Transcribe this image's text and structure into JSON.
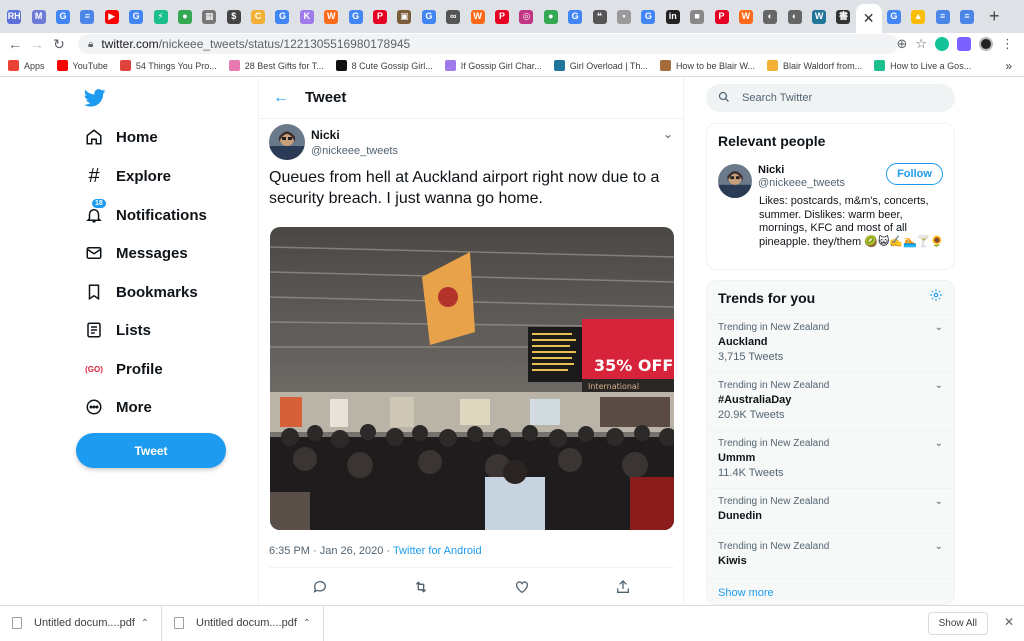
{
  "browser": {
    "tabs": [
      {
        "icon": "outline-icon",
        "color": "#5b6fd8",
        "glyph": "RH"
      },
      {
        "icon": "bookmark-icon",
        "color": "#6d7bd6",
        "glyph": "M"
      },
      {
        "icon": "google-icon",
        "color": "#4285f4",
        "glyph": "G"
      },
      {
        "icon": "docs-icon",
        "color": "#4a86e8",
        "glyph": "≡"
      },
      {
        "icon": "youtube-icon",
        "color": "#ff0000",
        "glyph": "▶"
      },
      {
        "icon": "google-icon",
        "color": "#4285f4",
        "glyph": "G"
      },
      {
        "icon": "zap-icon",
        "color": "#1bbf8e",
        "glyph": "⚡"
      },
      {
        "icon": "circle-icon",
        "color": "#34a853",
        "glyph": "●"
      },
      {
        "icon": "grid-icon",
        "color": "#777777",
        "glyph": "▦"
      },
      {
        "icon": "dollar-icon",
        "color": "#444444",
        "glyph": "$"
      },
      {
        "icon": "tag-icon",
        "color": "#f2b134",
        "glyph": "C"
      },
      {
        "icon": "google-icon",
        "color": "#4285f4",
        "glyph": "G"
      },
      {
        "icon": "ks-icon",
        "color": "#9f7aea",
        "glyph": "K"
      },
      {
        "icon": "w-icon",
        "color": "#ff6a1a",
        "glyph": "W"
      },
      {
        "icon": "google-icon",
        "color": "#4285f4",
        "glyph": "G"
      },
      {
        "icon": "pinterest-icon",
        "color": "#e60023",
        "glyph": "P"
      },
      {
        "icon": "frame-icon",
        "color": "#7a5c3a",
        "glyph": "▣"
      },
      {
        "icon": "google-icon",
        "color": "#4285f4",
        "glyph": "G"
      },
      {
        "icon": "link-icon",
        "color": "#555555",
        "glyph": "∞"
      },
      {
        "icon": "w-icon",
        "color": "#ff6a1a",
        "glyph": "W"
      },
      {
        "icon": "pinterest-icon",
        "color": "#e60023",
        "glyph": "P"
      },
      {
        "icon": "instagram-icon",
        "color": "#c13584",
        "glyph": "◎"
      },
      {
        "icon": "circle-icon",
        "color": "#34a853",
        "glyph": "●"
      },
      {
        "icon": "google-icon",
        "color": "#4285f4",
        "glyph": "G"
      },
      {
        "icon": "quote-icon",
        "color": "#555555",
        "glyph": "❝"
      },
      {
        "icon": "doc-icon",
        "color": "#999999",
        "glyph": "▪"
      },
      {
        "icon": "google-icon",
        "color": "#4285f4",
        "glyph": "G"
      },
      {
        "icon": "linkedin-icon",
        "color": "#222222",
        "glyph": "in"
      },
      {
        "icon": "square-icon",
        "color": "#888888",
        "glyph": "■"
      },
      {
        "icon": "pinterest-icon",
        "color": "#e60023",
        "glyph": "P"
      },
      {
        "icon": "w-icon",
        "color": "#ff6a1a",
        "glyph": "W"
      },
      {
        "icon": "globe-icon",
        "color": "#666666",
        "glyph": "◐"
      },
      {
        "icon": "globe-icon",
        "color": "#666666",
        "glyph": "◐"
      },
      {
        "icon": "wordpress-icon",
        "color": "#21759b",
        "glyph": "W"
      },
      {
        "icon": "book-icon",
        "color": "#333333",
        "glyph": "書"
      }
    ],
    "tabs_after_active": [
      {
        "icon": "google-icon",
        "color": "#4285f4",
        "glyph": "G"
      },
      {
        "icon": "drive-icon",
        "color": "#fbbc04",
        "glyph": "▲"
      },
      {
        "icon": "docs-icon",
        "color": "#4a86e8",
        "glyph": "≡"
      },
      {
        "icon": "docs-icon",
        "color": "#4a86e8",
        "glyph": "≡"
      }
    ],
    "active_tab_close": "✕",
    "new_tab": "+",
    "url_host": "twitter.com",
    "url_path": "/nickeee_tweets/status/1221305516980178945",
    "bookmarks": [
      {
        "label": "Apps",
        "icon": "apps-icon",
        "color": "#ea4335"
      },
      {
        "label": "YouTube",
        "icon": "youtube-icon",
        "color": "#ff0000"
      },
      {
        "label": "54 Things You Pro...",
        "icon": "zap-icon",
        "color": "#e0433b"
      },
      {
        "label": "28 Best Gifts for T...",
        "icon": "c-icon",
        "color": "#e879b0"
      },
      {
        "label": "8 Cute Gossip Girl...",
        "icon": "seventeen-icon",
        "color": "#111111"
      },
      {
        "label": "If Gossip Girl Char...",
        "icon": "ks-icon",
        "color": "#9f7aea"
      },
      {
        "label": "Girl Overload | Th...",
        "icon": "wordpress-icon",
        "color": "#21759b"
      },
      {
        "label": "How to be Blair W...",
        "icon": "wh-icon",
        "color": "#a66b3a"
      },
      {
        "label": "Blair Waldorf from...",
        "icon": "ct-icon",
        "color": "#f2b134"
      },
      {
        "label": "How to Live a Gos...",
        "icon": "zap-icon",
        "color": "#1bbf8e"
      }
    ],
    "bookmarks_more": "»"
  },
  "nav": {
    "items": [
      {
        "label": "Home",
        "icon": "home-icon"
      },
      {
        "label": "Explore",
        "icon": "hashtag-icon"
      },
      {
        "label": "Notifications",
        "icon": "bell-icon",
        "badge": "18"
      },
      {
        "label": "Messages",
        "icon": "mail-icon"
      },
      {
        "label": "Bookmarks",
        "icon": "bookmark-icon"
      },
      {
        "label": "Lists",
        "icon": "list-icon"
      },
      {
        "label": "Profile",
        "icon": "profile-avatar-icon"
      },
      {
        "label": "More",
        "icon": "more-icon"
      }
    ],
    "tweet_button": "Tweet"
  },
  "tweet": {
    "header": "Tweet",
    "author_name": "Nicki",
    "author_handle": "@nickeee_tweets",
    "text": "Queues from hell at Auckland airport right now due to a security breach. I just wanna go home.",
    "timestamp": "6:35 PM · Jan 26, 2020 · ",
    "source": "Twitter for Android",
    "photo_sign": "35% OFF",
    "photo_sign_sub": "International"
  },
  "sidebar": {
    "search_placeholder": "Search Twitter",
    "relevant_title": "Relevant people",
    "person_name": "Nicki",
    "person_handle": "@nickeee_tweets",
    "follow": "Follow",
    "bio": "Likes: postcards, m&m's, concerts, summer. Dislikes: warm beer, mornings, KFC and most of all pineapple. they/them 🥝😺✍️🏊🍸🌻",
    "trends_title": "Trends for you",
    "trends": [
      {
        "meta": "Trending in New Zealand",
        "name": "Auckland",
        "count": "3,715 Tweets"
      },
      {
        "meta": "Trending in New Zealand",
        "name": "#AustraliaDay",
        "count": "20.9K Tweets"
      },
      {
        "meta": "Trending in New Zealand",
        "name": "Ummm",
        "count": "11.4K Tweets"
      },
      {
        "meta": "Trending in New Zealand",
        "name": "Dunedin",
        "count": ""
      },
      {
        "meta": "Trending in New Zealand",
        "name": "Kiwis",
        "count": ""
      }
    ],
    "show_more": "Show more"
  },
  "downloads": {
    "items": [
      "Untitled docum....pdf",
      "Untitled docum....pdf"
    ],
    "show_all": "Show All"
  },
  "colors": {
    "twitter_blue": "#1d9bf0",
    "text": "#0f1419",
    "muted": "#536471"
  }
}
